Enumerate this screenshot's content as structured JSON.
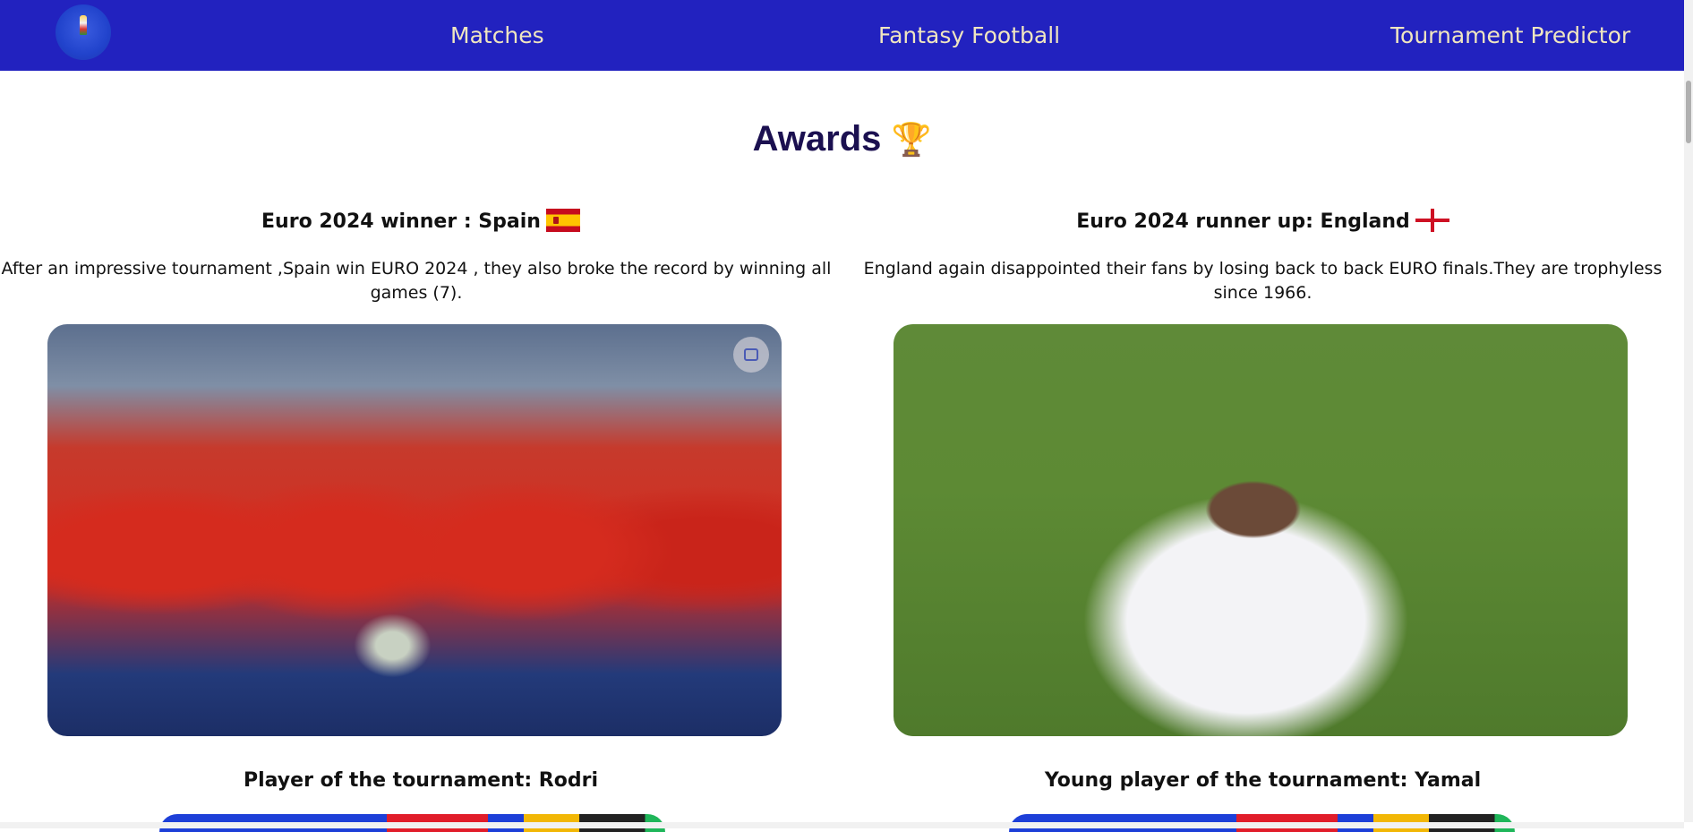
{
  "nav": {
    "logo_alt": "UEFA EURO 2024 logo",
    "links": [
      "Matches",
      "Fantasy Football",
      "Tournament Predictor"
    ]
  },
  "page": {
    "title": "Awards",
    "title_emoji": "🏆"
  },
  "awards": {
    "winner": {
      "heading": "Euro 2024 winner : Spain",
      "description": "After an impressive tournament ,Spain win EURO 2024 , they also broke the record by winning all games (7).",
      "flag": "spain-flag"
    },
    "runner_up": {
      "heading": "Euro 2024 runner up: England",
      "description": "England again disappointed their fans by losing back to back EURO finals.They are trophyless since 1966.",
      "flag": "england-flag"
    },
    "player": {
      "heading": "Player of the tournament: Rodri"
    },
    "young_player": {
      "heading": "Young player of the tournament: Yamal"
    }
  },
  "colors": {
    "navbar": "#2222bf",
    "nav_text": "#f0e6c0",
    "title": "#1b1050"
  }
}
